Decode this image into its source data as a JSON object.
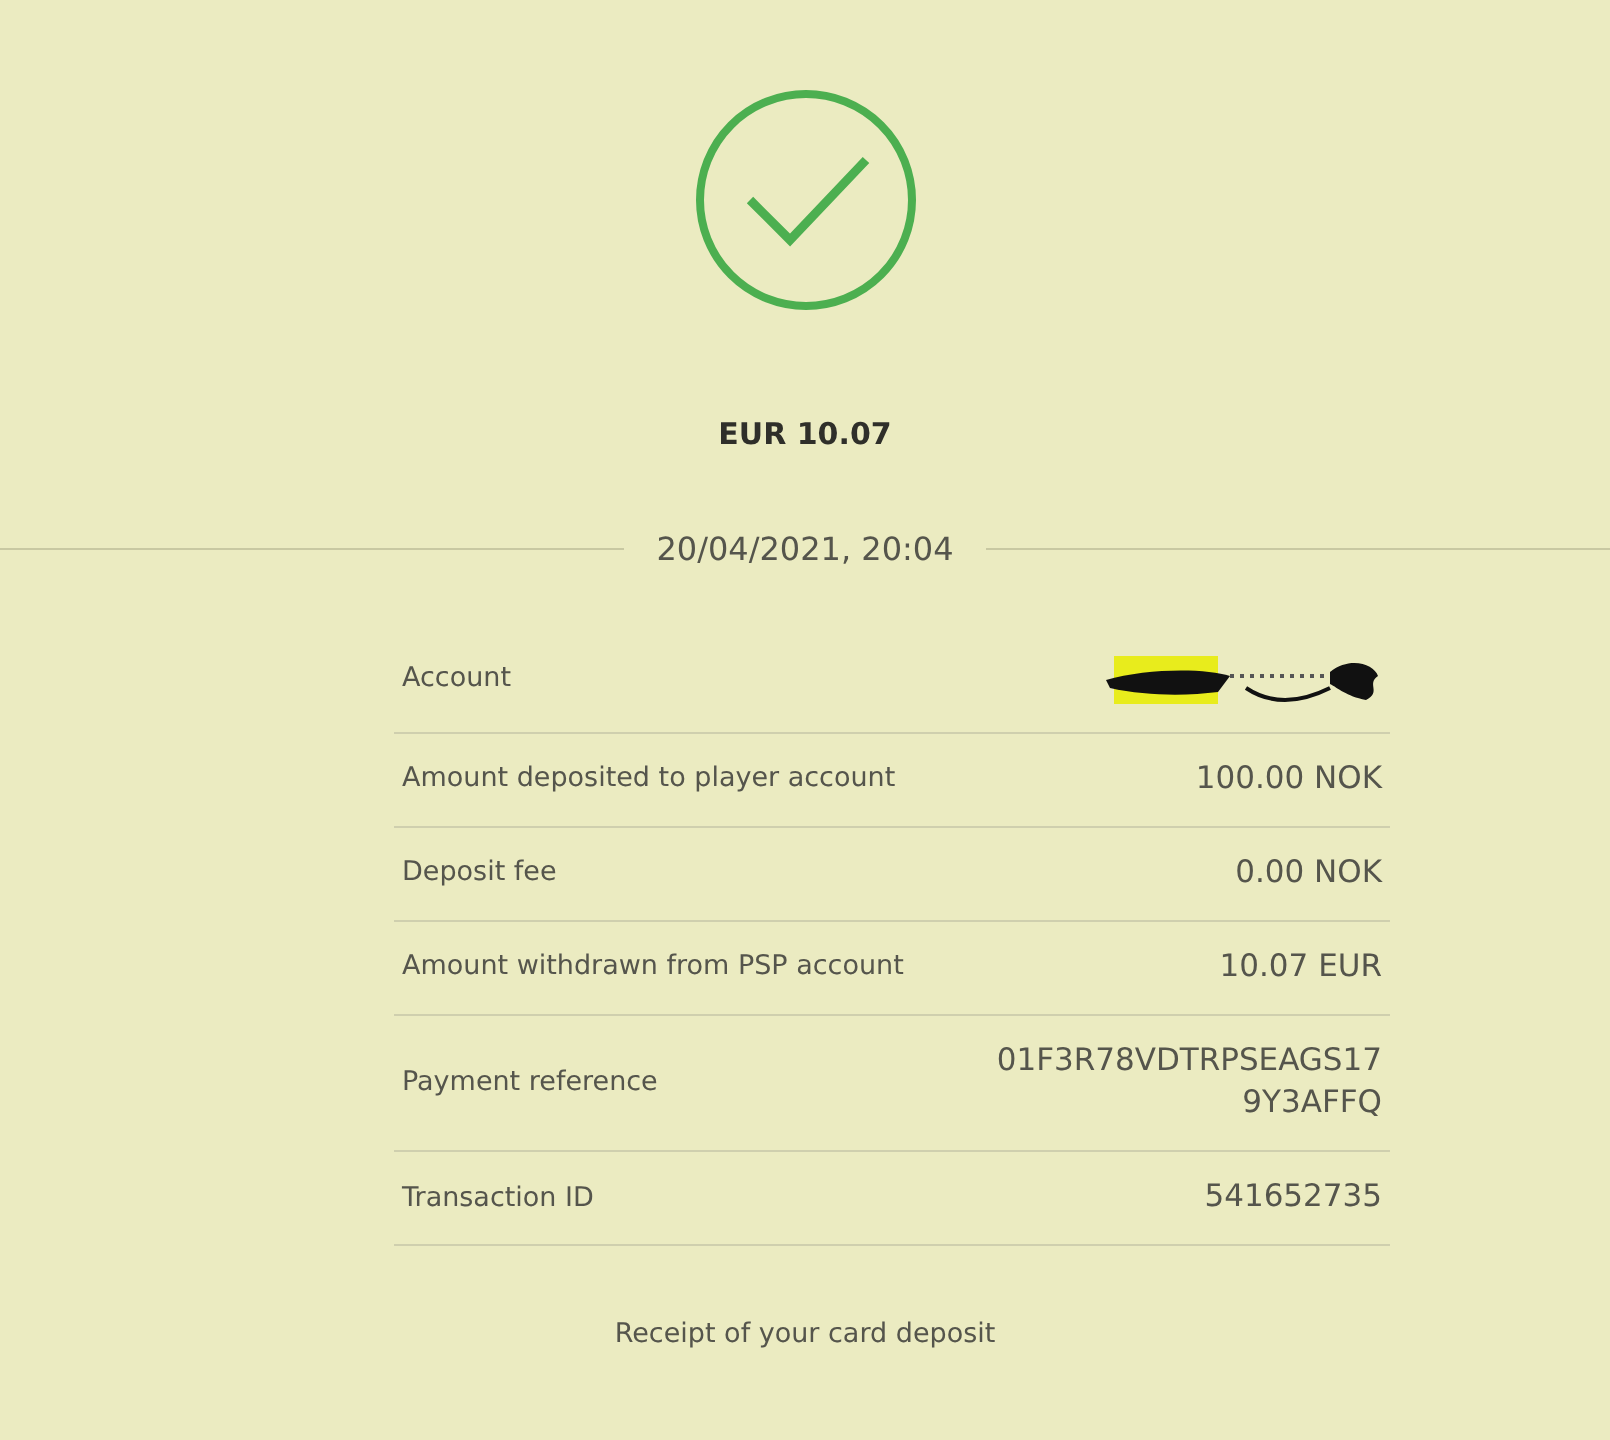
{
  "amount": "EUR 10.07",
  "date": "20/04/2021, 20:04",
  "rows": [
    {
      "label": "Account",
      "kind": "redacted"
    },
    {
      "label": "Amount deposited to player account",
      "kind": "text",
      "value": "100.00 NOK"
    },
    {
      "label": "Deposit fee",
      "kind": "text",
      "value": "0.00 NOK"
    },
    {
      "label": "Amount withdrawn from PSP account",
      "kind": "text",
      "value": "10.07 EUR"
    },
    {
      "label": "Payment reference",
      "kind": "text",
      "value": "01F3R78VDTRPSEAGS179Y3AFFQ"
    },
    {
      "label": "Transaction ID",
      "kind": "text",
      "value": "541652735"
    }
  ],
  "footer": "Receipt of your card deposit"
}
